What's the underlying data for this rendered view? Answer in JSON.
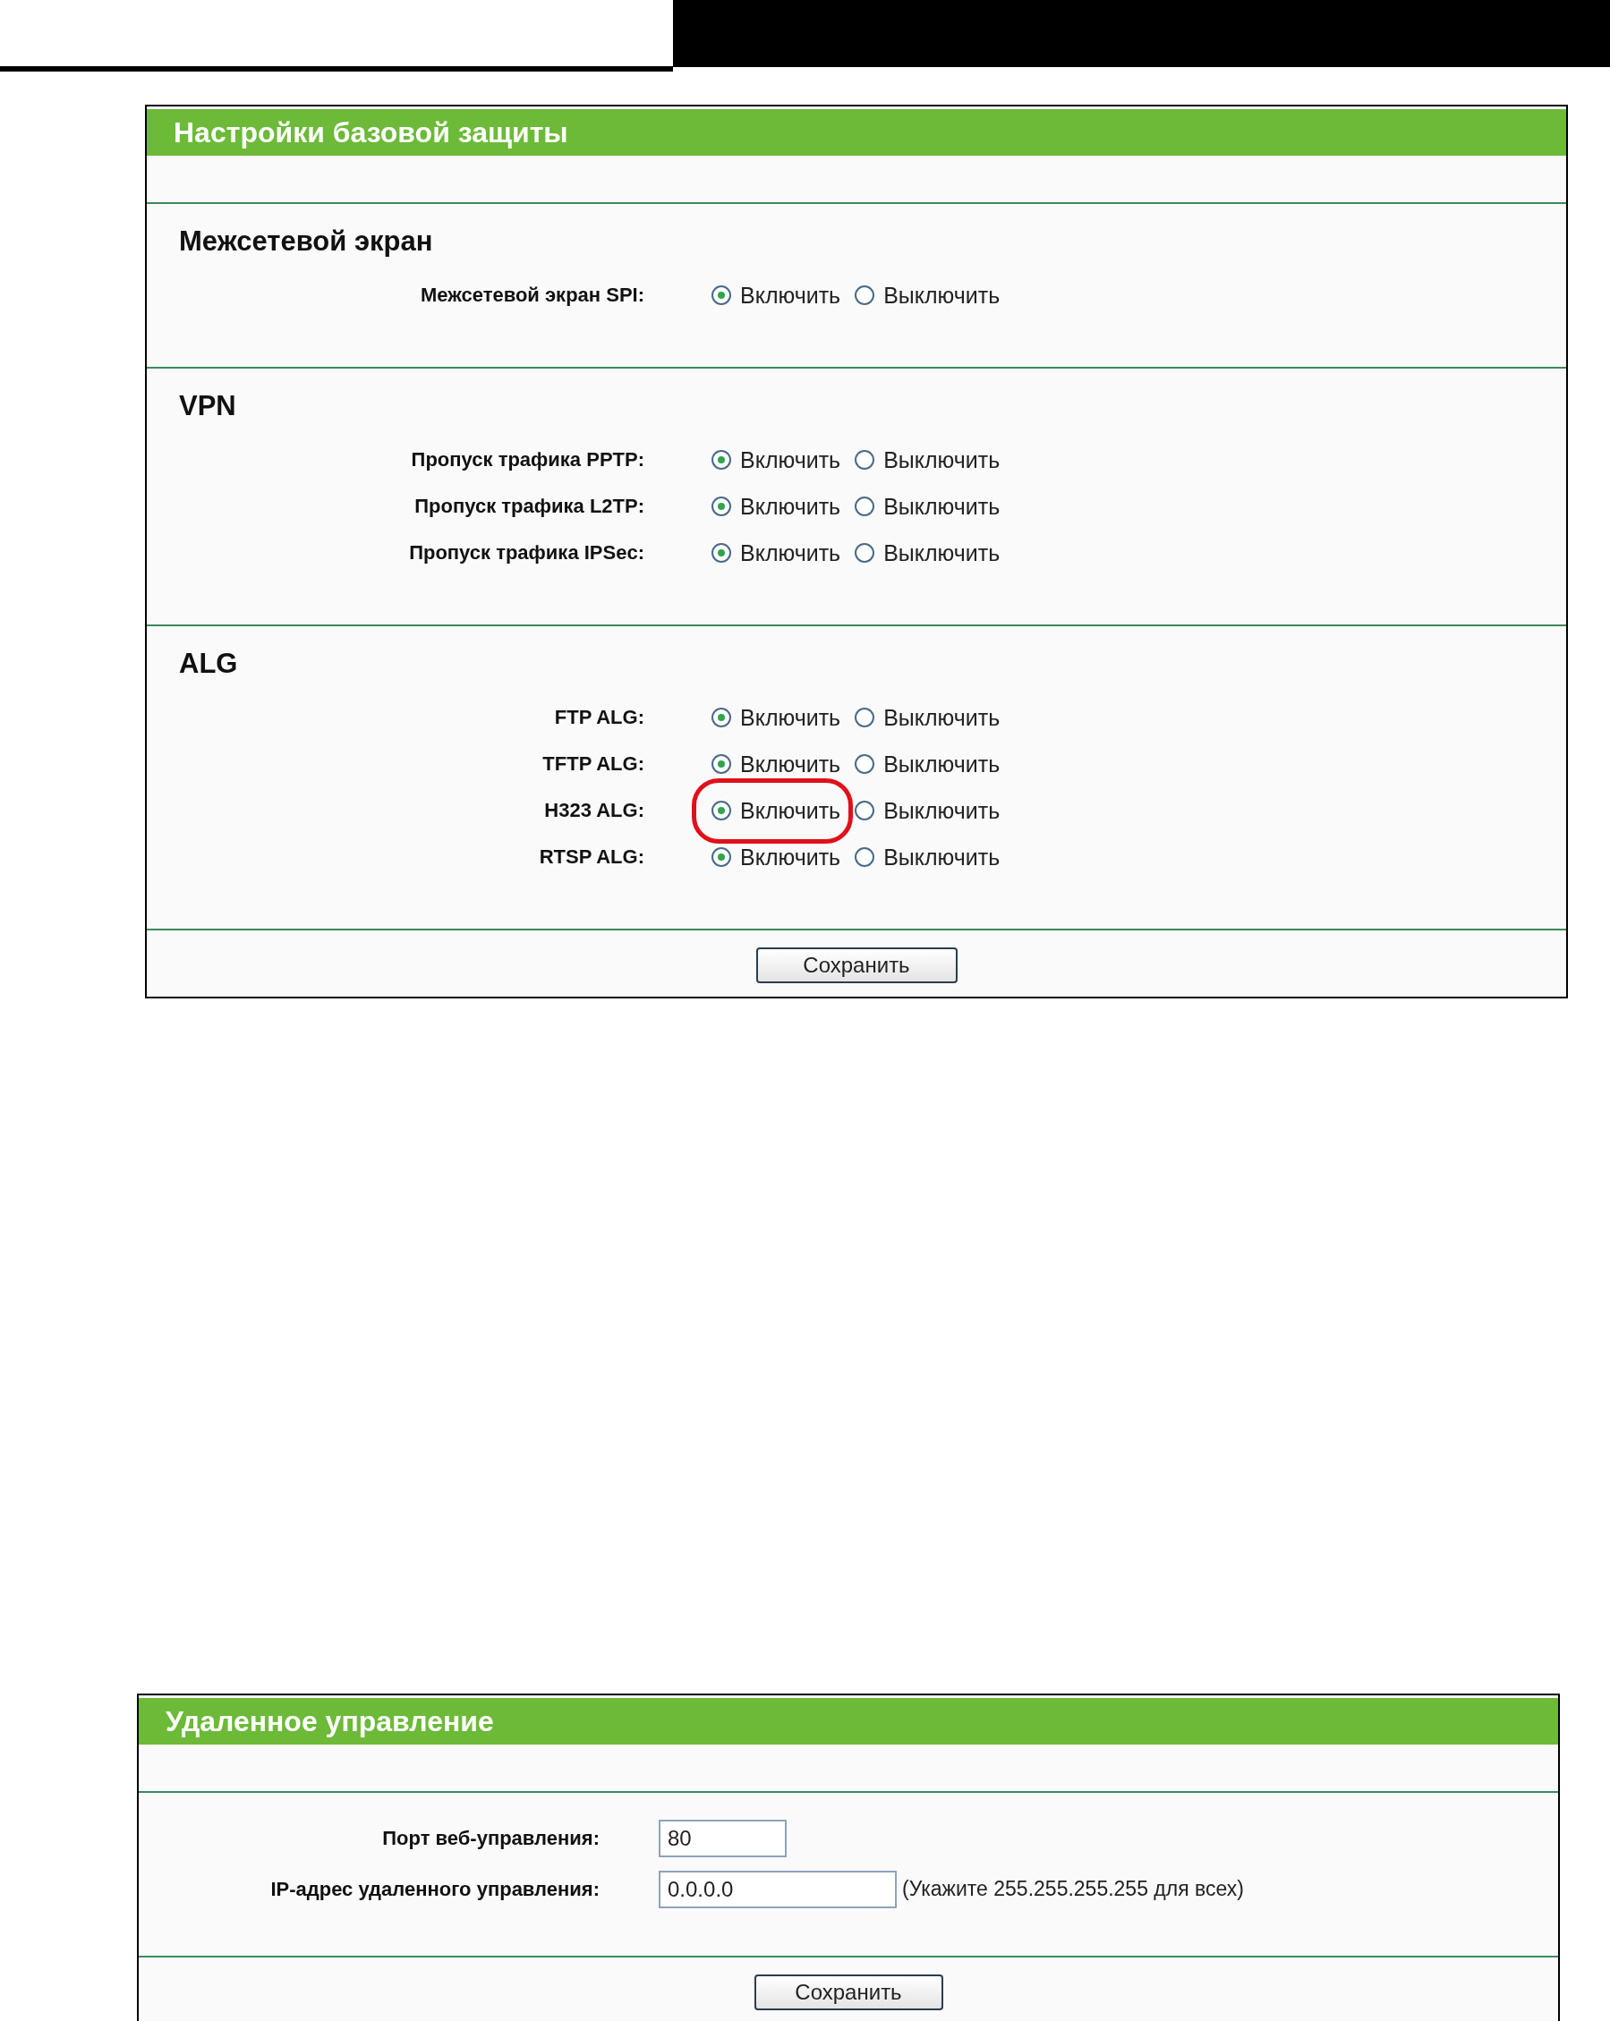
{
  "security_panel": {
    "title": "Настройки базовой защиты",
    "sections": [
      {
        "title": "Межсетевой экран",
        "rows": [
          {
            "label": "Межсетевой экран SPI:",
            "highlighted": false,
            "options": [
              {
                "label": "Включить",
                "selected": true
              },
              {
                "label": "Выключить",
                "selected": false
              }
            ]
          }
        ]
      },
      {
        "title": "VPN",
        "rows": [
          {
            "label": "Пропуск трафика PPTP:",
            "highlighted": false,
            "options": [
              {
                "label": "Включить",
                "selected": true
              },
              {
                "label": "Выключить",
                "selected": false
              }
            ]
          },
          {
            "label": "Пропуск трафика L2TP:",
            "highlighted": false,
            "options": [
              {
                "label": "Включить",
                "selected": true
              },
              {
                "label": "Выключить",
                "selected": false
              }
            ]
          },
          {
            "label": "Пропуск трафика IPSec:",
            "highlighted": false,
            "options": [
              {
                "label": "Включить",
                "selected": true
              },
              {
                "label": "Выключить",
                "selected": false
              }
            ]
          }
        ]
      },
      {
        "title": "ALG",
        "rows": [
          {
            "label": "FTP ALG:",
            "highlighted": false,
            "options": [
              {
                "label": "Включить",
                "selected": true
              },
              {
                "label": "Выключить",
                "selected": false
              }
            ]
          },
          {
            "label": "TFTP ALG:",
            "highlighted": false,
            "options": [
              {
                "label": "Включить",
                "selected": true
              },
              {
                "label": "Выключить",
                "selected": false
              }
            ]
          },
          {
            "label": "H323 ALG:",
            "highlighted": true,
            "options": [
              {
                "label": "Включить",
                "selected": true
              },
              {
                "label": "Выключить",
                "selected": false
              }
            ]
          },
          {
            "label": "RTSP ALG:",
            "highlighted": false,
            "options": [
              {
                "label": "Включить",
                "selected": true
              },
              {
                "label": "Выключить",
                "selected": false
              }
            ]
          }
        ]
      }
    ],
    "button": "Сохранить"
  },
  "remote_panel": {
    "title": "Удаленное управление",
    "fields": [
      {
        "label": "Порт веб-управления:",
        "value": "80"
      },
      {
        "label": "IP-адрес удаленного управления:",
        "value": "0.0.0.0",
        "hint": "(Укажите 255.255.255.255 для всех)"
      }
    ],
    "button": "Сохранить"
  }
}
